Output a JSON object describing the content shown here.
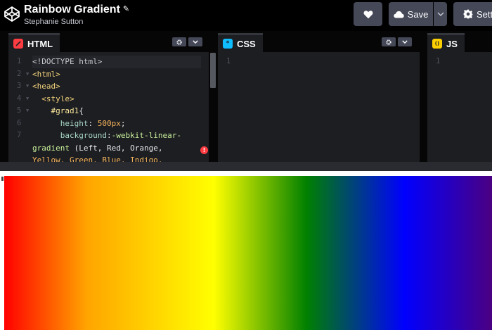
{
  "header": {
    "logo_icon": "codepen-logo-icon",
    "title": "Rainbow Gradient",
    "edit_icon": "pencil-icon",
    "author": "Stephanie Sutton",
    "buttons": {
      "love_icon": "heart-icon",
      "save_icon": "cloud-icon",
      "save_label": "Save",
      "save_dropdown_icon": "chevron-down-icon",
      "settings_icon": "gear-icon",
      "settings_label": "Setti"
    }
  },
  "editors": {
    "html": {
      "label": "HTML",
      "icon_color": "#ff3c41",
      "lines": [
        "1",
        "2",
        "3",
        "4",
        "5",
        "6",
        "7",
        "",
        "",
        ""
      ]
    },
    "css": {
      "label": "CSS",
      "icon_glyph": "*",
      "icon_color": "#0ebeff",
      "lines": [
        "1"
      ]
    },
    "js": {
      "label": "JS",
      "icon_glyph": "()",
      "icon_color": "#fcd000",
      "lines": [
        "1"
      ]
    }
  },
  "html_code": {
    "l1": "<!DOCTYPE html>",
    "l2": "<html>",
    "l3": "<head>",
    "l4": "<style>",
    "l5_sel": "#grad1",
    "l5_brace": "{",
    "l6_prop": "height",
    "l6_colon": ": ",
    "l6_val": "500px",
    "l6_semi": ";",
    "l7_prop": "background",
    "l7_colon": ":",
    "l7_fn": "-webkit-linear-",
    "l8_fn": "gradient",
    "l8_rest": " (Left, Red, Orange,",
    "l9": "Yellow, Green, Blue, Indigo,"
  },
  "preview": {
    "gradient_colors": [
      "#ff0000",
      "#ffa500",
      "#ffff00",
      "#008000",
      "#0000ff",
      "#4b0082"
    ]
  }
}
